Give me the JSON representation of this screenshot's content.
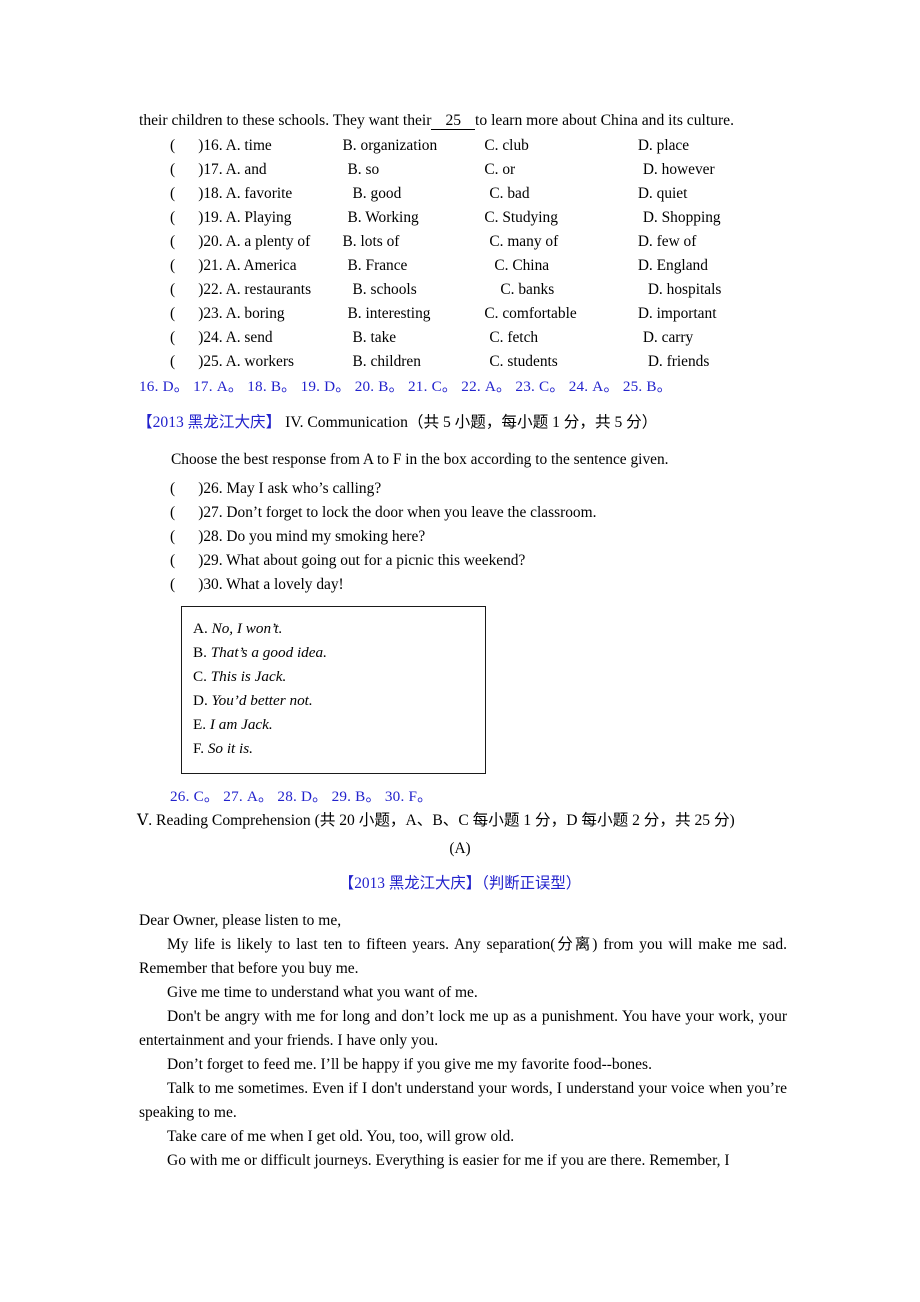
{
  "cloze": {
    "intro_before": "their children to these schools. They want their",
    "blank_number": "25",
    "intro_after": "to learn more about China and its culture.",
    "columns": [
      "A",
      "B",
      "C",
      "D"
    ],
    "items": [
      {
        "marker": "(      )",
        "number": "16.",
        "a": "A. time",
        "b": "B. organization",
        "c": "C. club",
        "d": "D. place"
      },
      {
        "marker": "(      )",
        "number": "17.",
        "a": "A. and",
        "b": "B. so",
        "c": "C. or",
        "d": "D. however"
      },
      {
        "marker": "(      )",
        "number": "18.",
        "a": "A. favorite",
        "b": "B. good",
        "c": "C. bad",
        "d": "D. quiet"
      },
      {
        "marker": "(      )",
        "number": "19.",
        "a": "A. Playing",
        "b": "B. Working",
        "c": "C. Studying",
        "d": "D. Shopping"
      },
      {
        "marker": "(      )",
        "number": "20.",
        "a": "A. a plenty of",
        "b": "B. lots of",
        "c": "C. many of",
        "d": "D. few of"
      },
      {
        "marker": "(      )",
        "number": "21.",
        "a": "A. America",
        "b": "B. France",
        "c": "C. China",
        "d": "D. England"
      },
      {
        "marker": "(      )",
        "number": "22.",
        "a": "A. restaurants",
        "b": "B. schools",
        "c": "C. banks",
        "d": "D. hospitals"
      },
      {
        "marker": "(      )",
        "number": "23.",
        "a": "A. boring",
        "b": "B. interesting",
        "c": "C. comfortable",
        "d": "D. important"
      },
      {
        "marker": "(      )",
        "number": "24.",
        "a": "A. send",
        "b": "B. take",
        "c": "C. fetch",
        "d": "D. carry"
      },
      {
        "marker": "(      )",
        "number": "25.",
        "a": "A. workers",
        "b": "B. children",
        "c": "C. students",
        "d": "D. friends"
      }
    ],
    "answers_line": "16. D。 17. A。 18. B。 19. D。 20. B。 21. C。 22. A。 23. C。 24. A。 25. B。"
  },
  "communication": {
    "source_tag": "【2013 黑龙江大庆】",
    "heading": " IV. Communication（共 5 小题，每小题 1 分，共 5 分）",
    "instruction": "Choose the best response from A to F in the box according to the sentence given.",
    "questions": [
      {
        "marker": "(      )",
        "text": "26. May I ask who’s calling?"
      },
      {
        "marker": "(      )",
        "text": "27. Don’t forget to lock the door when you leave the classroom."
      },
      {
        "marker": "(      )",
        "text": "28. Do you mind my smoking here?"
      },
      {
        "marker": "(      )",
        "text": "29. What about going out for a picnic this weekend?"
      },
      {
        "marker": "(      )",
        "text": "30. What a lovely day!"
      }
    ],
    "response_box": [
      {
        "letter": "A.",
        "text": "No, I won’t."
      },
      {
        "letter": "B.",
        "text": "That’s a good idea."
      },
      {
        "letter": "C.",
        "text": "This is Jack."
      },
      {
        "letter": "D.",
        "text": "You’d better not."
      },
      {
        "letter": "E.",
        "text": "I am Jack."
      },
      {
        "letter": "F.",
        "text": "So it is."
      }
    ],
    "answers_line": "26. C。 27. A。 28. D。 29. B。 30. F。"
  },
  "reading": {
    "heading": "Ⅴ. Reading Comprehension (共 20 小题，A、B、C 每小题 1 分，D 每小题 2 分，共 25 分)",
    "part_label": "(A)",
    "source_tag": "【2013 黑龙江大庆】（判断正误型）",
    "passage": [
      {
        "indent": false,
        "text": "Dear Owner, please listen to me,"
      },
      {
        "indent": true,
        "text": "My life is likely to last ten to fifteen years. Any separation(分离) from you will make me sad. Remember that before you buy me."
      },
      {
        "indent": true,
        "text": "Give me time to understand what you want of me."
      },
      {
        "indent": true,
        "text": "Don't be angry with me for long and don’t lock me up as a punishment. You have your work, your entertainment and your friends. I have only you."
      },
      {
        "indent": true,
        "text": "Don’t forget to feed me. I’ll be happy if you give me my favorite food--bones."
      },
      {
        "indent": true,
        "text": "Talk to me sometimes. Even if I don't understand your words, I understand your voice when you’re speaking to me."
      },
      {
        "indent": true,
        "text": "Take care of me when I get old. You, too, will grow old."
      },
      {
        "indent": true,
        "text": "Go with me or difficult journeys. Everything is easier for me if you are there. Remember, I"
      }
    ]
  },
  "colors": {
    "answer_blue": "#2222cc",
    "text_black": "#000000",
    "box_border": "#1a1a1a"
  }
}
